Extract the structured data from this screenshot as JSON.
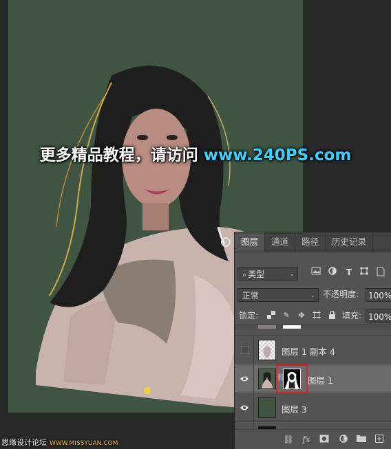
{
  "watermark": {
    "text": "更多精品教程，请访问",
    "site": "www.240PS.com"
  },
  "footer_logo": {
    "text": "思缘设计论坛",
    "url": "WWW.MISSYUAN.COM"
  },
  "layers_panel": {
    "tabs": [
      {
        "label": "图层",
        "active": true
      },
      {
        "label": "通道",
        "active": false
      },
      {
        "label": "路径",
        "active": false
      },
      {
        "label": "历史记录",
        "active": false
      }
    ],
    "filter": {
      "selected": "类型"
    },
    "blend_mode": "正常",
    "opacity_label": "不透明度:",
    "opacity_value": "100%",
    "lock_label": "锁定:",
    "fill_label": "填充:",
    "fill_value": "100%",
    "layers": [
      {
        "name": "图层 1 副本 4",
        "visible": false,
        "selected": false
      },
      {
        "name": "图层 1",
        "visible": true,
        "selected": true
      },
      {
        "name": "图层 3",
        "visible": true,
        "selected": false
      }
    ]
  },
  "colors": {
    "canvas_bg": "#3f5541",
    "panel_bg": "#535353",
    "selected_layer": "#6b6b6b",
    "mask_highlight": "#e0262a"
  }
}
